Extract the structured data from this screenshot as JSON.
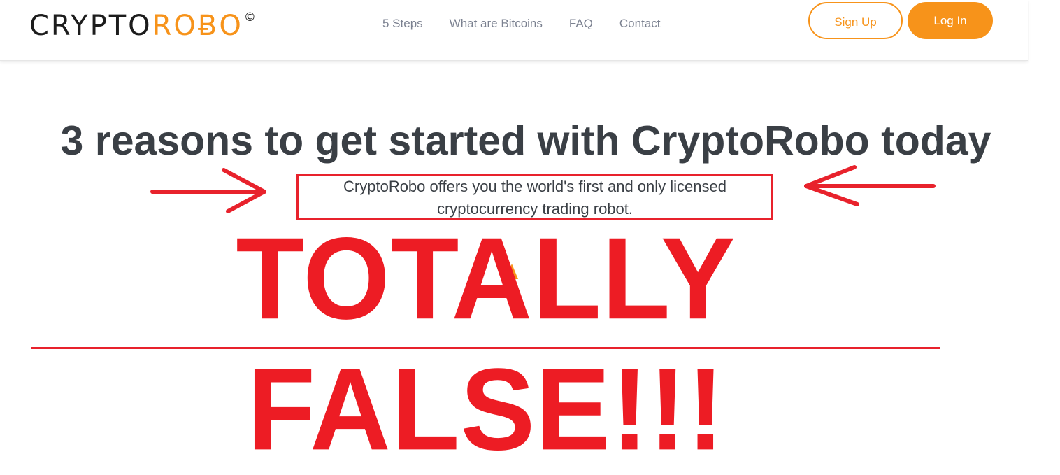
{
  "header": {
    "logo": {
      "part1": "CRYPTO",
      "part2": "ROɃO",
      "mark": "©"
    },
    "nav": [
      "5 Steps",
      "What are Bitcoins",
      "FAQ",
      "Contact"
    ],
    "signup_label": "Sign Up",
    "login_label": "Log In"
  },
  "hero": {
    "headline": "3 reasons to get started with CryptoRobo today",
    "subtext_line1": "CryptoRobo offers you the world's first and only licensed",
    "subtext_line2": "cryptocurrency trading robot."
  },
  "overlay": {
    "stamp_text": "TOTALLY FALSE!!!",
    "color": "#ed1c24"
  },
  "colors": {
    "accent": "#f7931a",
    "heading": "#3a3f45",
    "nav": "#7b8190"
  }
}
